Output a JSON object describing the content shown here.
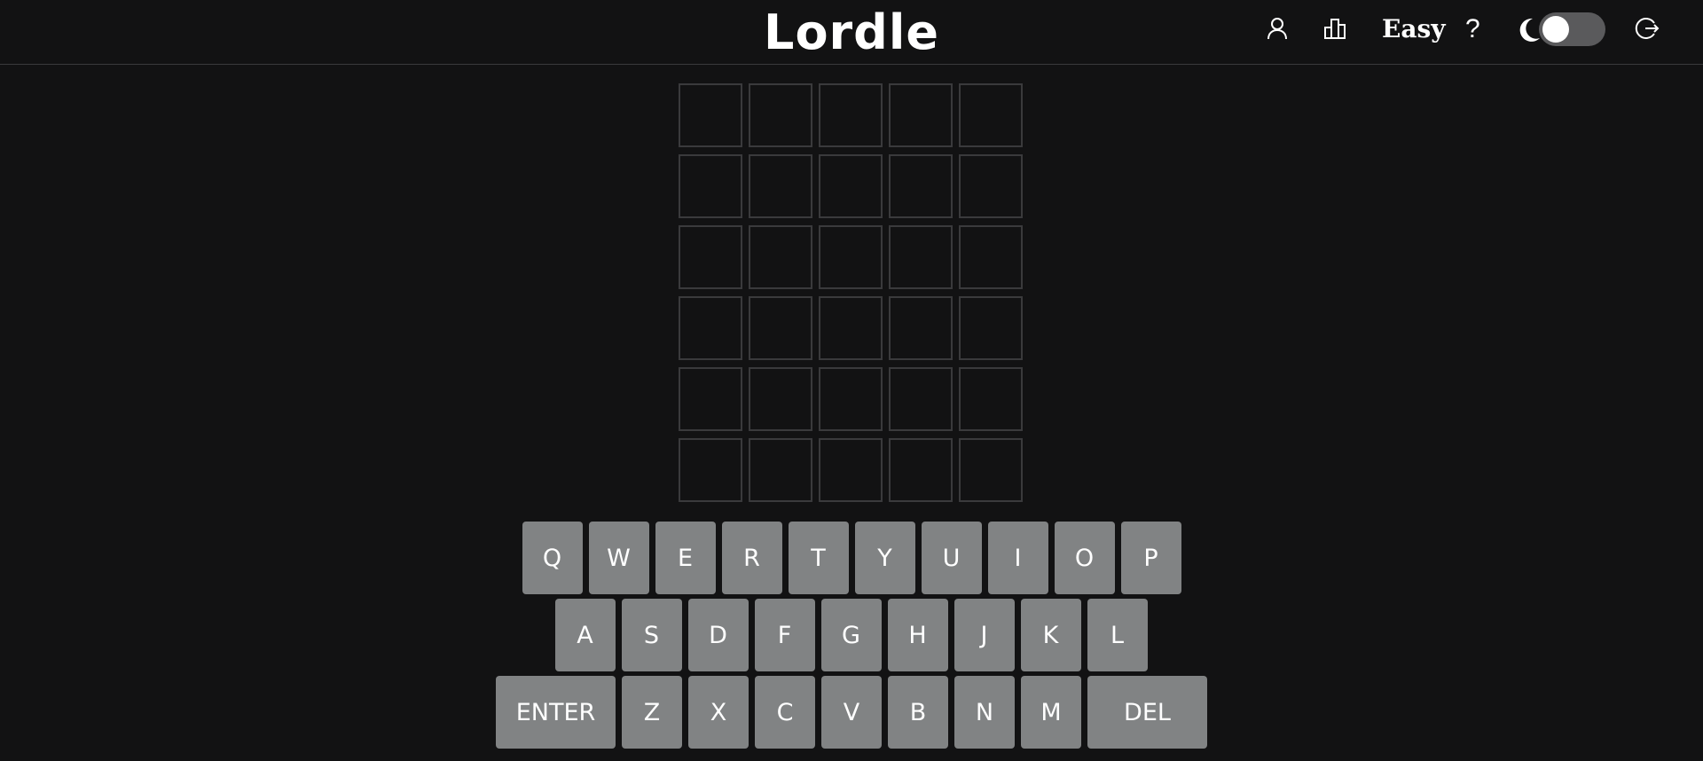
{
  "header": {
    "title": "Lordle",
    "difficulty_label": "Easy",
    "help_label": "?",
    "icons": [
      "user-icon",
      "stats-icon",
      "moon-icon",
      "logout-icon"
    ],
    "dark_mode_enabled": true
  },
  "board": {
    "rows": 6,
    "cols": 5,
    "tiles": [
      [
        "",
        "",
        "",
        "",
        ""
      ],
      [
        "",
        "",
        "",
        "",
        ""
      ],
      [
        "",
        "",
        "",
        "",
        ""
      ],
      [
        "",
        "",
        "",
        "",
        ""
      ],
      [
        "",
        "",
        "",
        "",
        ""
      ],
      [
        "",
        "",
        "",
        "",
        ""
      ]
    ]
  },
  "keyboard": {
    "row1": [
      "Q",
      "W",
      "E",
      "R",
      "T",
      "Y",
      "U",
      "I",
      "O",
      "P"
    ],
    "row2": [
      "A",
      "S",
      "D",
      "F",
      "G",
      "H",
      "J",
      "K",
      "L"
    ],
    "row3": [
      "ENTER",
      "Z",
      "X",
      "C",
      "V",
      "B",
      "N",
      "M",
      "DEL"
    ]
  },
  "colors": {
    "background": "#121213",
    "tile_border": "#3a3a3c",
    "key_background": "#818384",
    "text": "#ffffff",
    "toggle_track": "#5a5a5c"
  }
}
